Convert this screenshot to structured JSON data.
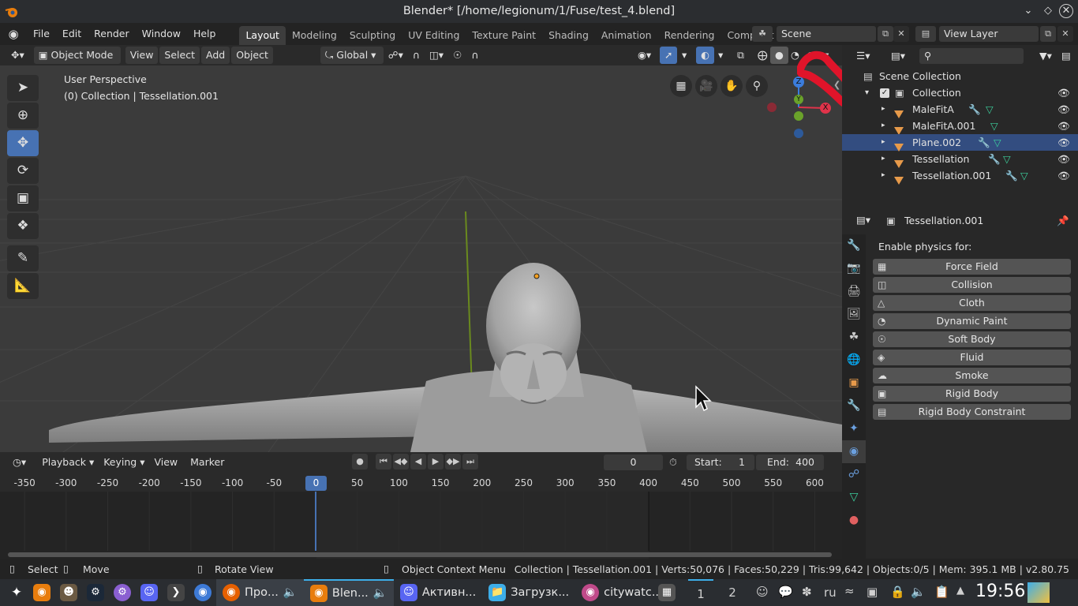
{
  "window": {
    "title": "Blender* [/home/legionum/1/Fuse/test_4.blend]",
    "controls": [
      "chevron-down",
      "diamond",
      "chevron-up",
      "close"
    ]
  },
  "menubar": {
    "items": [
      "File",
      "Edit",
      "Render",
      "Window",
      "Help"
    ]
  },
  "workspaces": {
    "tabs": [
      "Layout",
      "Modeling",
      "Sculpting",
      "UV Editing",
      "Texture Paint",
      "Shading",
      "Animation",
      "Rendering",
      "Compositin"
    ],
    "active": "Layout"
  },
  "scene": {
    "value": "Scene"
  },
  "view_layer": {
    "value": "View Layer"
  },
  "viewport_header": {
    "mode": "Object Mode",
    "menus": [
      "View",
      "Select",
      "Add",
      "Object"
    ],
    "orientation": "Global"
  },
  "viewport": {
    "perspective": "User Perspective",
    "collection_info": "(0) Collection | Tessellation.001",
    "gizmo": {
      "z": "Z",
      "y": "Y",
      "x": "X"
    }
  },
  "outliner": {
    "root": "Scene Collection",
    "collection": "Collection",
    "items": [
      {
        "name": "MaleFitA",
        "selected": false
      },
      {
        "name": "MaleFitA.001",
        "selected": false
      },
      {
        "name": "Plane.002",
        "selected": true
      },
      {
        "name": "Tessellation",
        "selected": false
      },
      {
        "name": "Tessellation.001",
        "selected": false
      }
    ]
  },
  "properties": {
    "object": "Tessellation.001",
    "section_title": "Enable physics for:",
    "buttons": [
      "Force Field",
      "Collision",
      "Cloth",
      "Dynamic Paint",
      "Soft Body",
      "Fluid",
      "Smoke",
      "Rigid Body",
      "Rigid Body Constraint"
    ]
  },
  "timeline": {
    "menus": [
      "Playback",
      "Keying",
      "View",
      "Marker"
    ],
    "current_frame": "0",
    "start_label": "Start:",
    "start": "1",
    "end_label": "End:",
    "end": "400",
    "ruler": [
      "-350",
      "-300",
      "-250",
      "-200",
      "-150",
      "-100",
      "-50",
      "0",
      "50",
      "100",
      "150",
      "200",
      "250",
      "300",
      "350",
      "400",
      "450",
      "500",
      "550",
      "600"
    ]
  },
  "statusbar": {
    "select": "Select",
    "move": "Move",
    "rotate": "Rotate View",
    "context": "Object Context Menu",
    "stats": "Collection | Tessellation.001 | Verts:50,076 | Faces:50,229 | Tris:99,642 | Objects:0/5 | Mem: 395.1 MB | v2.80.75"
  },
  "taskbar": {
    "tasks": [
      "Про...",
      "Blen...",
      "Активн...",
      "Загрузк...",
      "citywatc..."
    ],
    "desktops": [
      "1",
      "2"
    ],
    "lang": "ru",
    "clock": "19:56"
  },
  "colors": {
    "accent": "#4772b3",
    "selected_row": "#334d80",
    "annotation": "#e0142a",
    "object_orange": "#e79a4a"
  }
}
